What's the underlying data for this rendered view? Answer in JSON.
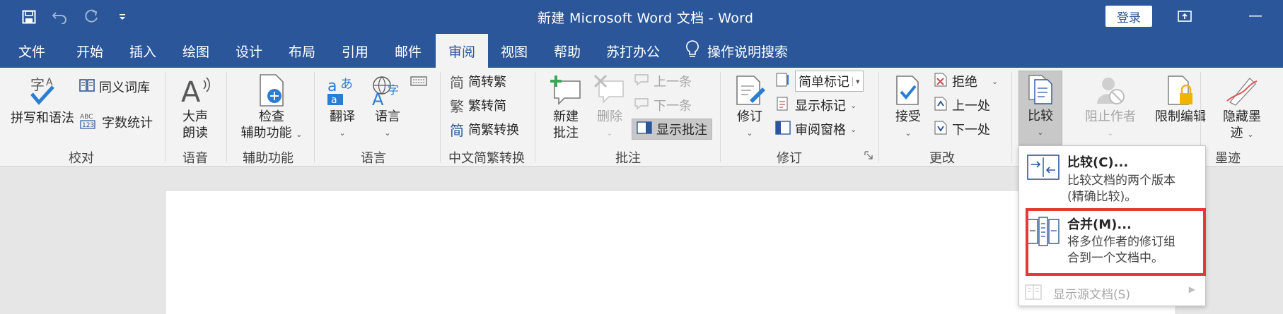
{
  "titlebar": {
    "title": "新建 Microsoft Word 文档  -  Word",
    "login": "登录",
    "qat_icons": [
      "save-icon",
      "undo-icon",
      "redo-icon",
      "customize-qat-icon"
    ]
  },
  "menu": {
    "tabs": [
      "文件",
      "开始",
      "插入",
      "绘图",
      "设计",
      "布局",
      "引用",
      "邮件",
      "审阅",
      "视图",
      "帮助",
      "苏打办公"
    ],
    "active": "审阅",
    "tellme": "操作说明搜索"
  },
  "ribbon": {
    "proofing": {
      "spell": "拼写和语法",
      "thesaurus": "同义词库",
      "wordcount": "字数统计",
      "label": "校对"
    },
    "speech": {
      "read_aloud_1": "大声",
      "read_aloud_2": "朗读",
      "label": "语音"
    },
    "accessibility": {
      "check_1": "检查",
      "check_2": "辅助功能",
      "label": "辅助功能"
    },
    "language": {
      "translate": "翻译",
      "language": "语言",
      "label": "语言"
    },
    "chinese": {
      "to_trad": "简转繁",
      "to_simp": "繁转简",
      "convert": "简繁转换",
      "label": "中文简繁转换"
    },
    "comments": {
      "new_1": "新建",
      "new_2": "批注",
      "delete": "删除",
      "prev": "上一条",
      "next": "下一条",
      "show": "显示批注",
      "label": "批注"
    },
    "tracking": {
      "track": "修订",
      "markup_select": "简单标记",
      "show_markup": "显示标记",
      "review_pane": "审阅窗格",
      "label": "修订"
    },
    "changes": {
      "accept": "接受",
      "reject": "拒绝",
      "prev": "上一处",
      "next": "下一处",
      "label": "更改"
    },
    "compare": {
      "compare": "比较"
    },
    "protect": {
      "block_1": "阻止作者",
      "restrict": "限制编辑"
    },
    "ink": {
      "hide_1": "隐藏墨",
      "hide_2": "迹",
      "label": "墨迹"
    }
  },
  "dropdown": {
    "compare_title": "比较(C)...",
    "compare_desc_1": "比较文档的两个版本",
    "compare_desc_2": "(精确比较)。",
    "combine_title": "合并(M)...",
    "combine_desc_1": "将多位作者的修订组",
    "combine_desc_2": "合到一个文档中。",
    "show_source": "显示源文档(S)"
  },
  "colors": {
    "accent": "#2b579a",
    "highlight": "#e53935"
  }
}
